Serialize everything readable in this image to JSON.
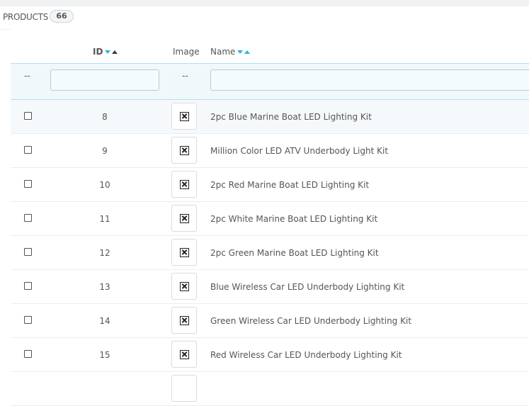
{
  "panel": {
    "title": "PRODUCTS",
    "count": "66"
  },
  "columns": {
    "id": "ID",
    "image": "Image",
    "name": "Name"
  },
  "filters": {
    "bulk_placeholder": "--",
    "image_placeholder": "--",
    "id_value": "",
    "name_value": ""
  },
  "icons": {
    "thumbnail": "broken-image-icon",
    "sort_desc": "caret-down-icon",
    "sort_asc": "caret-up-icon"
  },
  "colors": {
    "accent": "#25b9d7",
    "filter_bg": "#f0f8fc"
  },
  "products": [
    {
      "id": "8",
      "name": "2pc Blue Marine Boat LED Lighting Kit"
    },
    {
      "id": "9",
      "name": "Million Color LED ATV Underbody Light Kit"
    },
    {
      "id": "10",
      "name": "2pc Red Marine Boat LED Lighting Kit"
    },
    {
      "id": "11",
      "name": "2pc White Marine Boat LED Lighting Kit"
    },
    {
      "id": "12",
      "name": "2pc Green Marine Boat LED Lighting Kit"
    },
    {
      "id": "13",
      "name": "Blue Wireless Car LED Underbody Lighting Kit"
    },
    {
      "id": "14",
      "name": "Green Wireless Car LED Underbody Lighting Kit"
    },
    {
      "id": "15",
      "name": "Red Wireless Car LED Underbody Lighting Kit"
    }
  ]
}
